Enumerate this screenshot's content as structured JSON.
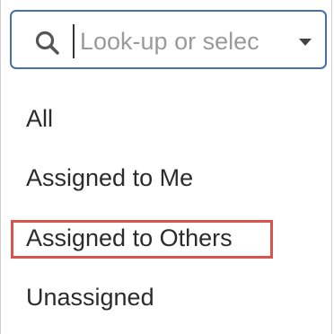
{
  "search": {
    "placeholder": "Look-up or selec",
    "value": "",
    "icon": "search-icon",
    "dropdown_icon": "chevron-down-icon"
  },
  "options": [
    {
      "label": "All"
    },
    {
      "label": "Assigned to Me"
    },
    {
      "label": "Assigned to Others",
      "highlighted": true
    },
    {
      "label": "Unassigned"
    }
  ],
  "colors": {
    "input_border": "#4a6fa5",
    "highlight": "#d9534f",
    "text": "#2b2b2b",
    "placeholder": "#9a9a9a"
  }
}
